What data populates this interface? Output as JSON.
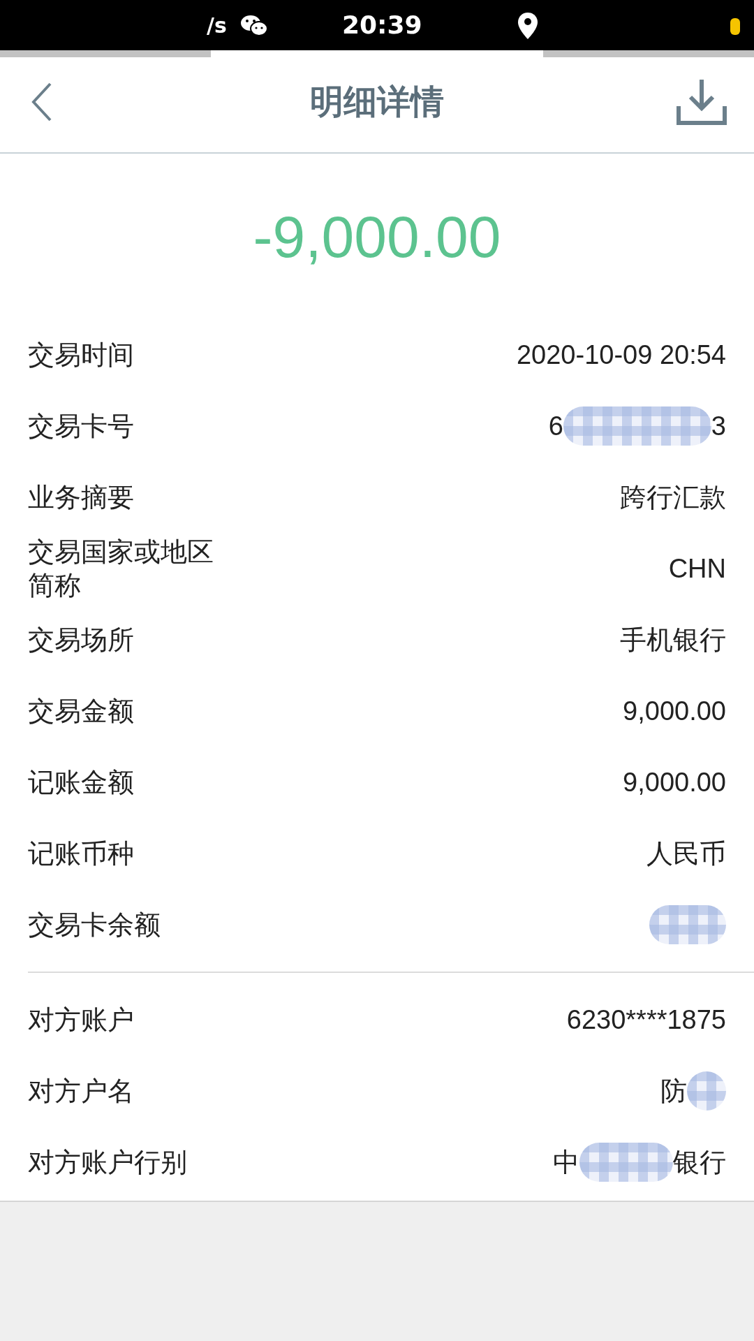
{
  "status_bar": {
    "speed": "/s",
    "time": "20:39"
  },
  "header": {
    "title": "明细详情"
  },
  "amount": "-9,000.00",
  "sections": [
    {
      "rows": [
        {
          "label": "交易时间",
          "value": [
            {
              "kind": "text",
              "text": "2020-10-09 20:54"
            }
          ]
        },
        {
          "label": "交易卡号",
          "value": [
            {
              "kind": "text",
              "text": "6"
            },
            {
              "kind": "pill"
            },
            {
              "kind": "text",
              "text": "3"
            }
          ]
        },
        {
          "label": "业务摘要",
          "value": [
            {
              "kind": "text",
              "text": "跨行汇款"
            }
          ]
        },
        {
          "label": "交易国家或地区简称",
          "value": [
            {
              "kind": "text",
              "text": "CHN"
            }
          ]
        },
        {
          "label": "交易场所",
          "value": [
            {
              "kind": "text",
              "text": "手机银行"
            }
          ]
        },
        {
          "label": "交易金额",
          "value": [
            {
              "kind": "text",
              "text": "9,000.00"
            }
          ]
        },
        {
          "label": "记账金额",
          "value": [
            {
              "kind": "text",
              "text": "9,000.00"
            }
          ]
        },
        {
          "label": "记账币种",
          "value": [
            {
              "kind": "text",
              "text": "人民币"
            }
          ]
        },
        {
          "label": "交易卡余额",
          "value": [
            {
              "kind": "blob"
            }
          ]
        }
      ]
    },
    {
      "rows": [
        {
          "label": "对方账户",
          "value": [
            {
              "kind": "text",
              "text": "6230****1875"
            }
          ]
        },
        {
          "label": "对方户名",
          "value": [
            {
              "kind": "text",
              "text": "防"
            },
            {
              "kind": "dot"
            }
          ]
        },
        {
          "label": "对方账户行别",
          "value": [
            {
              "kind": "text",
              "text": "中"
            },
            {
              "kind": "bar"
            },
            {
              "kind": "text",
              "text": "银行"
            }
          ]
        }
      ]
    }
  ]
}
